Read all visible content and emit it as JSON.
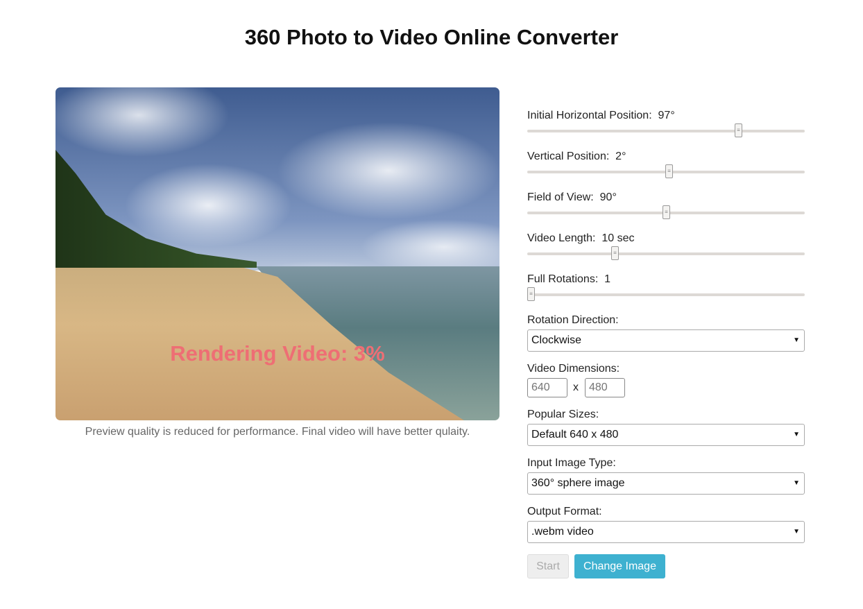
{
  "title": "360 Photo to Video Online Converter",
  "preview": {
    "overlay": "Rendering Video: 3%",
    "progress_percent": 3,
    "note": "Preview quality is reduced for performance. Final video will have better qulaity."
  },
  "sliders": [
    {
      "label": "Initial Horizontal Position:  97°",
      "fraction": 0.76
    },
    {
      "label": "Vertical Position:  2°",
      "fraction": 0.51
    },
    {
      "label": "Field of View:  90°",
      "fraction": 0.5
    },
    {
      "label": "Video Length:  10 sec",
      "fraction": 0.315
    },
    {
      "label": "Full Rotations:  1",
      "fraction": 0.0
    }
  ],
  "rotation": {
    "label": "Rotation Direction:",
    "value": "Clockwise"
  },
  "dimensions": {
    "label": "Video Dimensions:",
    "width_placeholder": "640",
    "height_placeholder": "480",
    "separator": "x"
  },
  "popular": {
    "label": "Popular Sizes:",
    "value": "Default 640 x 480"
  },
  "input_type": {
    "label": "Input Image Type:",
    "value": "360° sphere image"
  },
  "output": {
    "label": "Output Format:",
    "value": ".webm video"
  },
  "buttons": {
    "start": "Start",
    "change": "Change Image"
  },
  "colors": {
    "accent": "#3eb1d0",
    "overlay": "#ee6e74"
  }
}
